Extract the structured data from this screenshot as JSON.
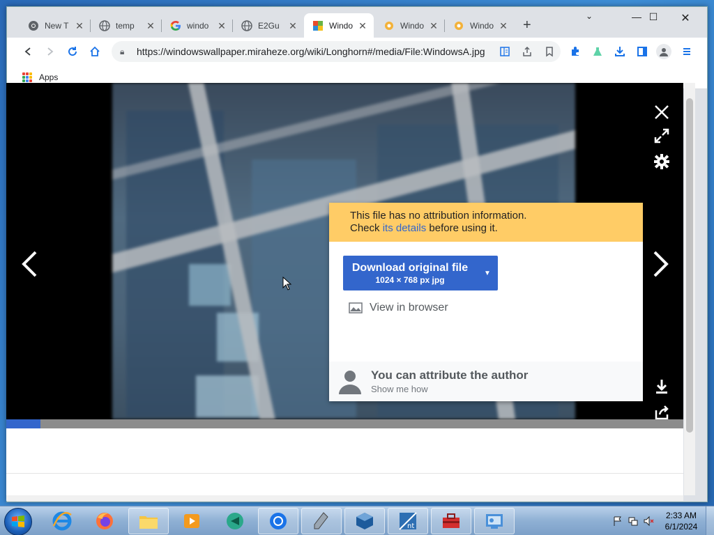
{
  "browser": {
    "tabs": [
      {
        "title": "New T",
        "icon": "chrome-icon"
      },
      {
        "title": "temp",
        "icon": "globe-icon"
      },
      {
        "title": "windo",
        "icon": "google-icon"
      },
      {
        "title": "E2Gu",
        "icon": "globe-icon"
      },
      {
        "title": "Windo",
        "icon": "wallpaper-favicon",
        "active": true
      },
      {
        "title": "Windo",
        "icon": "miraheze-icon"
      },
      {
        "title": "Windo",
        "icon": "miraheze-icon"
      }
    ],
    "new_tab_label": "+",
    "url": "https://windowswallpaper.miraheze.org/wiki/Longhorn#/media/File:WindowsA.jpg",
    "bookmarks": {
      "apps_label": "Apps"
    }
  },
  "viewer": {
    "progress_fraction": 0.05,
    "download_panel": {
      "warning_line1": "This file has no attribution information.",
      "warning_prefix": "Check ",
      "warning_link": "its details",
      "warning_suffix": " before using it.",
      "download_label": "Download original file",
      "download_sub": "1024 × 768 px jpg",
      "view_in_browser": "View in browser",
      "attrib_title": "You can attribute the author",
      "attrib_sub": "Show me how"
    }
  },
  "taskbar": {
    "time": "2:33 AM",
    "date": "6/1/2024"
  },
  "colors": {
    "accent": "#3366cc",
    "warning": "#ffcc66"
  }
}
